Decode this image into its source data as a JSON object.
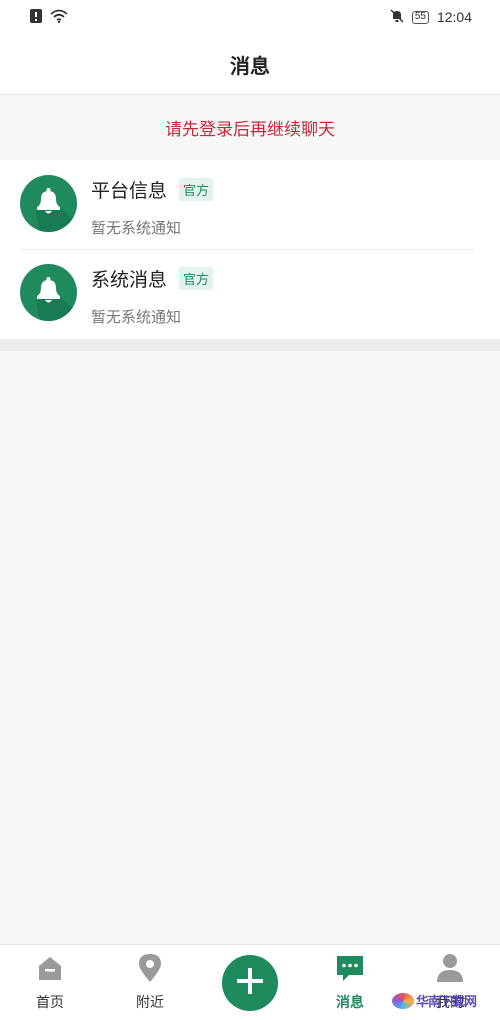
{
  "status_bar": {
    "time": "12:04",
    "battery": "55",
    "left_icons": [
      "alert-icon",
      "wifi-icon"
    ],
    "right_icons": [
      "mute-bell-icon",
      "battery-icon"
    ]
  },
  "header": {
    "title": "消息"
  },
  "banner": {
    "text": "请先登录后再继续聊天"
  },
  "messages": [
    {
      "title": "平台信息",
      "tag": "官方",
      "subtitle": "暂无系统通知",
      "icon": "bell-icon"
    },
    {
      "title": "系统消息",
      "tag": "官方",
      "subtitle": "暂无系统通知",
      "icon": "bell-icon"
    }
  ],
  "tabbar": {
    "items": [
      {
        "label": "首页",
        "icon": "home-icon"
      },
      {
        "label": "附近",
        "icon": "location-pin-icon"
      },
      {
        "label": "",
        "icon": "plus-icon"
      },
      {
        "label": "消息",
        "icon": "chat-icon",
        "active": true
      },
      {
        "label": "我的",
        "icon": "person-icon"
      }
    ]
  },
  "watermark": {
    "text": "华南下载网"
  },
  "colors": {
    "accent": "#1e8a5e",
    "banner_text": "#c8283a"
  }
}
